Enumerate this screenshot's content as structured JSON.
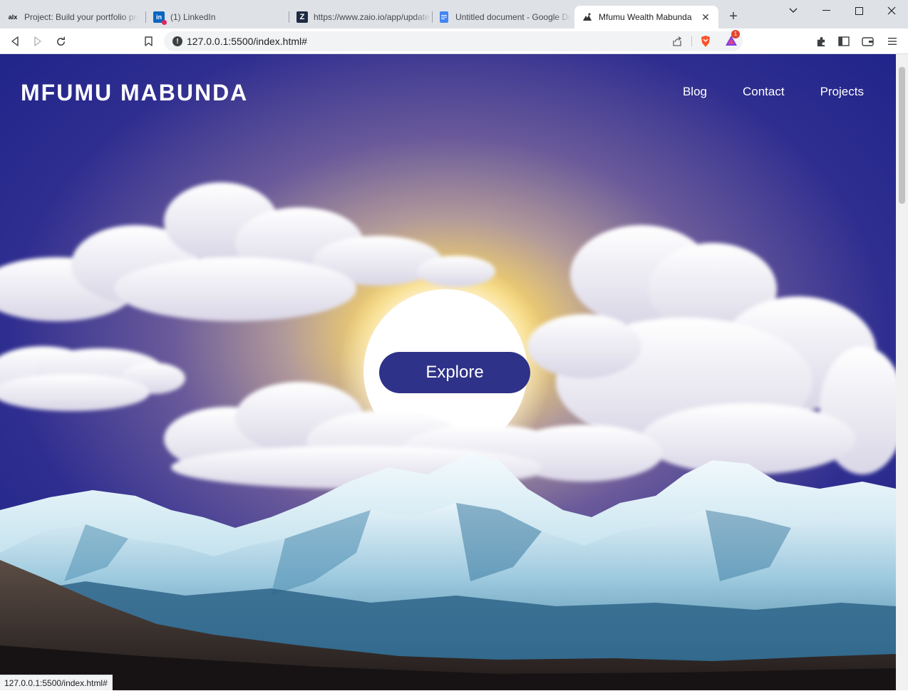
{
  "browser": {
    "tabs": [
      {
        "title": "Project: Build your portfolio project",
        "favicon": "alx-icon",
        "active": false
      },
      {
        "title": "(1) LinkedIn",
        "favicon": "linkedin-icon",
        "active": false
      },
      {
        "title": "https://www.zaio.io/app/update",
        "favicon": "zaio-icon",
        "active": false
      },
      {
        "title": "Untitled document - Google Docs",
        "favicon": "google-docs-icon",
        "active": false
      },
      {
        "title": "Mfumu Wealth Mabunda",
        "favicon": "site-icon",
        "active": true
      }
    ],
    "address": "127.0.0.1:5500/index.html#",
    "brave_badge": "1",
    "status_url": "127.0.0.1:5500/index.html#"
  },
  "site": {
    "logo": "MFUMU MABUNDA",
    "nav": [
      "Blog",
      "Contact",
      "Projects"
    ],
    "cta": "Explore"
  },
  "colors": {
    "sky_top": "#26278d",
    "sun_glow": "#f5d36a",
    "cta_bg": "#2f3289"
  }
}
